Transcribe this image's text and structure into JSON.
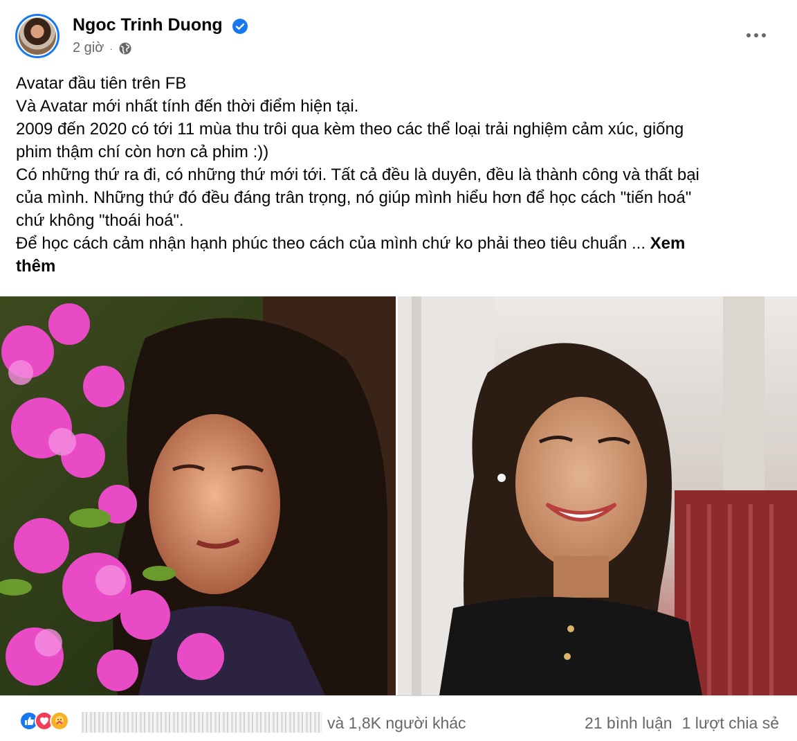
{
  "post": {
    "author": "Ngoc Trinh Duong",
    "time": "2 giờ",
    "privacy_icon": "globe-icon",
    "more_icon": "more-horizontal-icon",
    "text_lines": [
      "Avatar đầu tiên trên FB",
      "Và Avatar mới nhất tính đến thời điểm hiện tại.",
      "2009 đến 2020 có tới 11 mùa thu trôi qua kèm theo các thể loại trải nghiệm cảm xúc, giống",
      "phim thậm chí còn hơn cả phim :))",
      "Có những thứ ra đi, có những thứ mới tới. Tất cả đều là duyên, đều là thành công và thất bại",
      "của mình. Những thứ đó đều đáng trân trọng, nó giúp mình hiểu hơn để học cách \"tiến hoá\"",
      "chứ không \"thoái hoá\".",
      "Để học cách cảm nhận hạnh phúc theo cách của mình chứ ko phải theo tiêu chuẩn ..."
    ],
    "see_more_part1": "Xem",
    "see_more_part2": "thêm"
  },
  "footer": {
    "reaction_icons": [
      "like-icon",
      "love-icon",
      "care-icon"
    ],
    "reaction_text": "và 1,8K người khác",
    "comments": "21 bình luận",
    "shares": "1 lượt chia sẻ"
  },
  "colors": {
    "accent": "#1877f2",
    "secondary_text": "#65676b",
    "love": "#f33e58",
    "care": "#f7b125"
  }
}
